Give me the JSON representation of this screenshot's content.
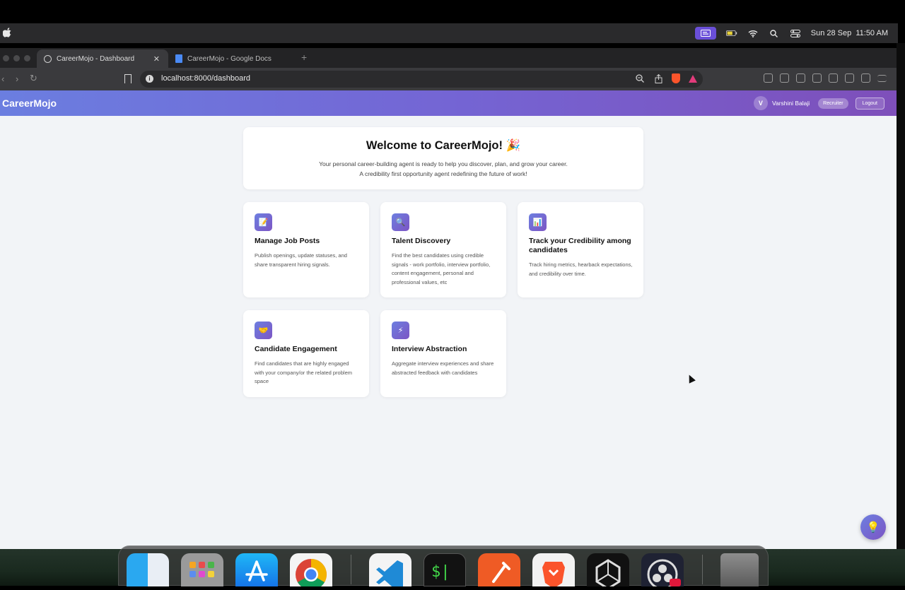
{
  "menubar": {
    "datetime": "Sun 28 Sep  11:50 AM"
  },
  "browser": {
    "tabs": [
      {
        "title": "CareerMojo - Dashboard",
        "active": true
      },
      {
        "title": "CareerMojo - Google Docs",
        "active": false
      }
    ],
    "url": "localhost:8000/dashboard"
  },
  "app": {
    "brand": "CareerMojo",
    "user": {
      "initial": "V",
      "name": "Varshini Balaji",
      "role": "Recruiter"
    },
    "logout_label": "Logout"
  },
  "welcome": {
    "title": "Welcome to CareerMojo! 🎉",
    "line1": "Your personal career-building agent is ready to help you discover, plan, and grow your career.",
    "line2": "A credibility first opportunity agent redefining the future of work!"
  },
  "cards": [
    {
      "icon": "memo-icon",
      "glyph": "📝",
      "title": "Manage Job Posts",
      "description": "Publish openings, update statuses, and share transparent hiring signals."
    },
    {
      "icon": "magnifier-icon",
      "glyph": "🔍",
      "title": "Talent Discovery",
      "description": "Find the best candidates using credible signals - work portfolio, interview portfolio, content engagement, personal and professional values, etc"
    },
    {
      "icon": "bar-chart-icon",
      "glyph": "📊",
      "title": "Track your Credibility among candidates",
      "description": "Track hiring metrics, hearback expectations, and credibility over time."
    },
    {
      "icon": "handshake-icon",
      "glyph": "🤝",
      "title": "Candidate Engagement",
      "description": "Find candidates that are highly engaged with your company/or the related problem space"
    },
    {
      "icon": "lightning-icon",
      "glyph": "⚡",
      "title": "Interview Abstraction",
      "description": "Aggregate interview experiences and share abstracted feedback with candidates"
    }
  ],
  "assistant": {
    "icon": "lightbulb-icon",
    "glyph": "💡"
  },
  "colors": {
    "accent_start": "#6b7ee0",
    "accent_end": "#7e4fba",
    "page_bg": "#f2f4f7"
  },
  "dock": {
    "apps": [
      "finder-icon",
      "launchpad-icon",
      "app-store-icon",
      "chrome-icon",
      "vscode-icon",
      "terminal-icon",
      "postman-icon",
      "brave-icon",
      "unity-icon",
      "obs-icon",
      "trash-icon"
    ]
  }
}
